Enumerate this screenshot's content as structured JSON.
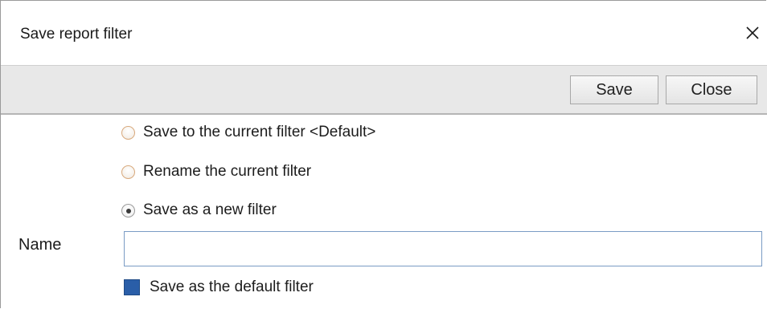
{
  "dialog": {
    "title": "Save report filter",
    "close_icon": "close-icon"
  },
  "toolbar": {
    "save_label": "Save",
    "close_label": "Close"
  },
  "options": {
    "save_current": {
      "label": "Save to the current filter <Default>",
      "selected": false
    },
    "rename_current": {
      "label": "Rename the current filter",
      "selected": false
    },
    "save_new": {
      "label": "Save as a new filter",
      "selected": true
    }
  },
  "name_field": {
    "label": "Name",
    "value": ""
  },
  "default_checkbox": {
    "label": "Save as the default filter",
    "checked": true
  },
  "colors": {
    "toolbar_bg": "#e8e8e8",
    "checkbox_fill": "#2a5ea8",
    "input_border": "#7a9bc4"
  }
}
